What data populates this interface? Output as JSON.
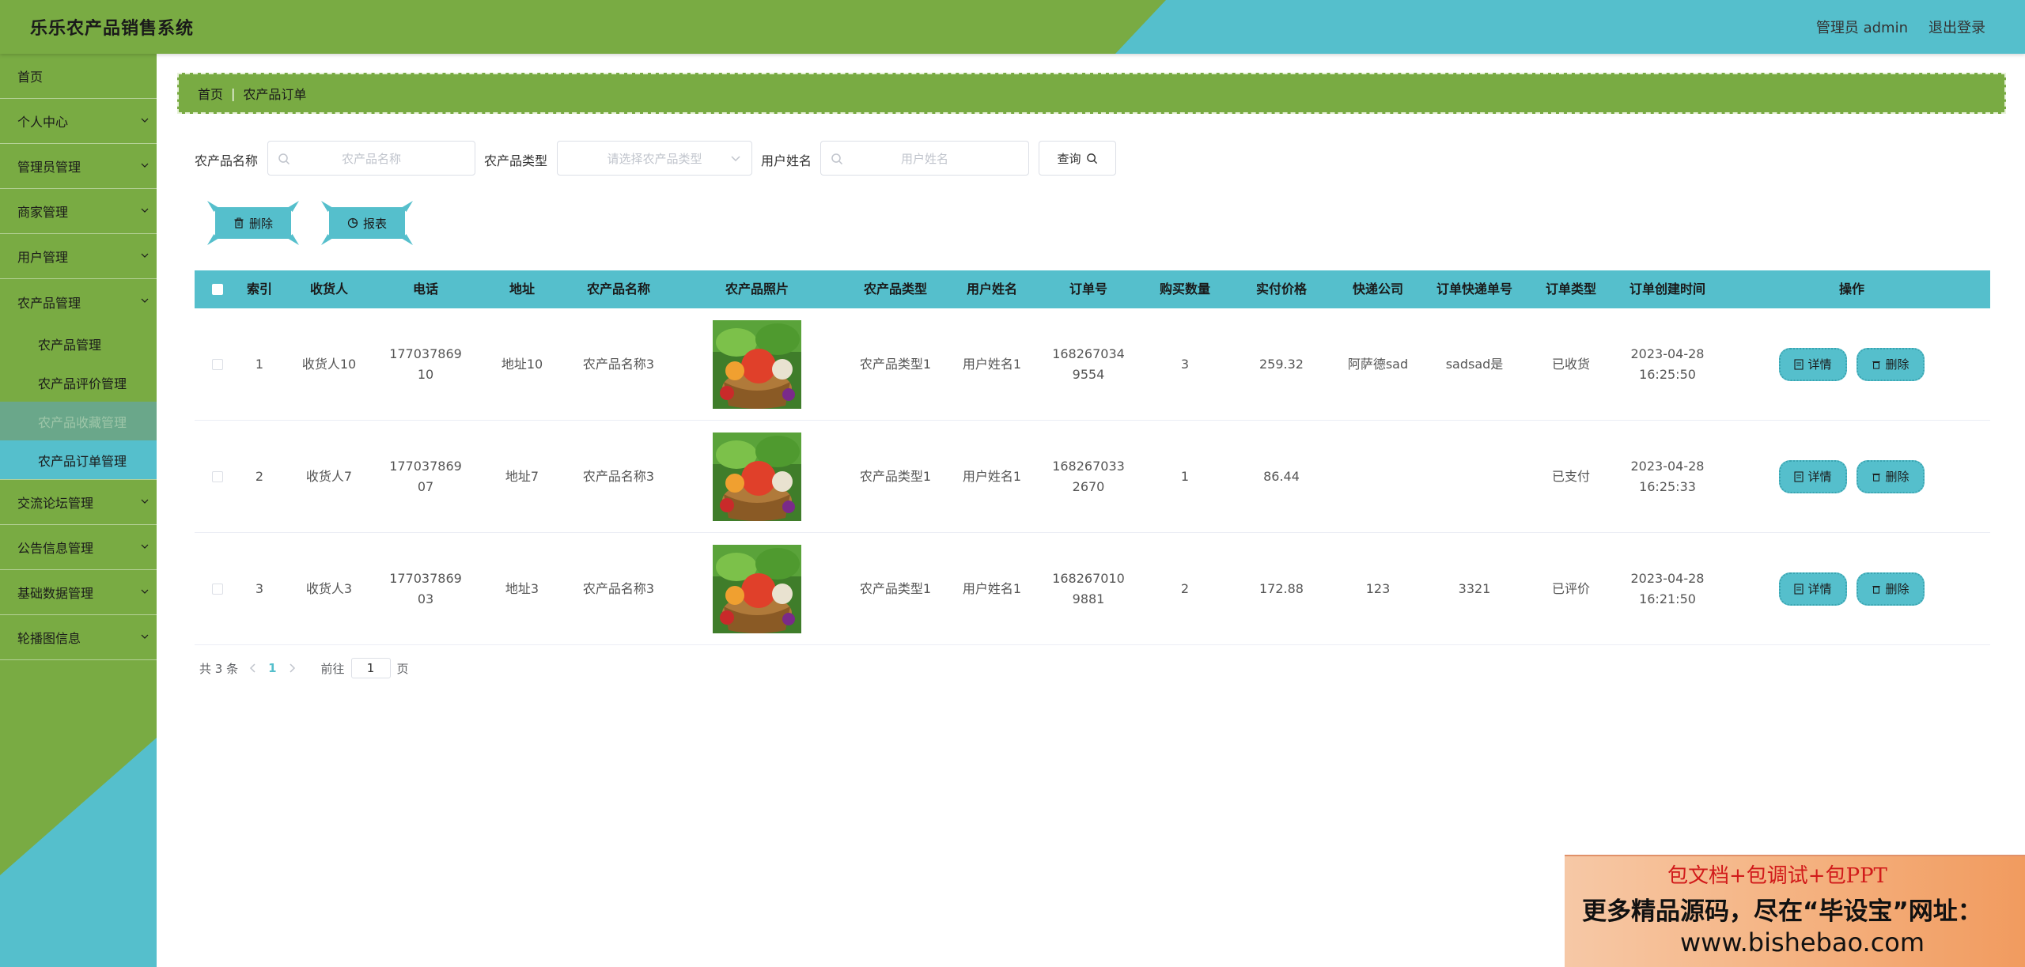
{
  "app": {
    "title": "乐乐农产品销售系统",
    "user": "管理员 admin",
    "logout": "退出登录"
  },
  "colors": {
    "primary_green": "#79ab43",
    "accent_teal": "#55bfcc"
  },
  "sidebar": {
    "items": [
      {
        "label": "首页",
        "has_children": false
      },
      {
        "label": "个人中心",
        "has_children": true
      },
      {
        "label": "管理员管理",
        "has_children": true
      },
      {
        "label": "商家管理",
        "has_children": true
      },
      {
        "label": "用户管理",
        "has_children": true
      },
      {
        "label": "农产品管理",
        "has_children": true,
        "expanded": true,
        "children": [
          "农产品管理",
          "农产品评价管理",
          "农产品收藏管理",
          "农产品订单管理"
        ]
      },
      {
        "label": "交流论坛管理",
        "has_children": true
      },
      {
        "label": "公告信息管理",
        "has_children": true
      },
      {
        "label": "基础数据管理",
        "has_children": true
      },
      {
        "label": "轮播图信息",
        "has_children": true
      }
    ]
  },
  "breadcrumb": {
    "home": "首页",
    "separator": "|",
    "current": "农产品订单"
  },
  "filters": {
    "name_label": "农产品名称",
    "name_placeholder": "农产品名称",
    "type_label": "农产品类型",
    "type_placeholder": "请选择农产品类型",
    "user_label": "用户姓名",
    "user_placeholder": "用户姓名",
    "query_label": "查询"
  },
  "actions": {
    "delete_label": "删除",
    "report_label": "报表"
  },
  "table": {
    "headers": [
      "索引",
      "收货人",
      "电话",
      "地址",
      "农产品名称",
      "农产品照片",
      "农产品类型",
      "用户姓名",
      "订单号",
      "购买数量",
      "实付价格",
      "快递公司",
      "订单快递单号",
      "订单类型",
      "订单创建时间",
      "操作"
    ],
    "rows": [
      {
        "index": "1",
        "receiver": "收货人10",
        "phone": "17703786910",
        "address": "地址10",
        "product": "农产品名称3",
        "type": "农产品类型1",
        "user": "用户姓名1",
        "order_no": "1682670349554",
        "qty": "3",
        "price": "259.32",
        "courier": "阿萨德sad",
        "tracking": "sadsad是",
        "status": "已收货",
        "created": "2023-04-28 16:25:50"
      },
      {
        "index": "2",
        "receiver": "收货人7",
        "phone": "17703786907",
        "address": "地址7",
        "product": "农产品名称3",
        "type": "农产品类型1",
        "user": "用户姓名1",
        "order_no": "1682670332670",
        "qty": "1",
        "price": "86.44",
        "courier": "",
        "tracking": "",
        "status": "已支付",
        "created": "2023-04-28 16:25:33"
      },
      {
        "index": "3",
        "receiver": "收货人3",
        "phone": "17703786903",
        "address": "地址3",
        "product": "农产品名称3",
        "type": "农产品类型1",
        "user": "用户姓名1",
        "order_no": "1682670109881",
        "qty": "2",
        "price": "172.88",
        "courier": "123",
        "tracking": "3321",
        "status": "已评价",
        "created": "2023-04-28 16:21:50"
      }
    ],
    "detail_label": "详情",
    "delete_label": "删除"
  },
  "pagination": {
    "total": "共 3 条",
    "current_page": "1",
    "goto_label": "前往",
    "goto_value": "1",
    "page_suffix": "页"
  },
  "ad": {
    "line1": "包文档+包调试+包PPT",
    "line2": "更多精品源码，尽在“毕设宝”网址：",
    "line3": "www.bishebao.com"
  }
}
